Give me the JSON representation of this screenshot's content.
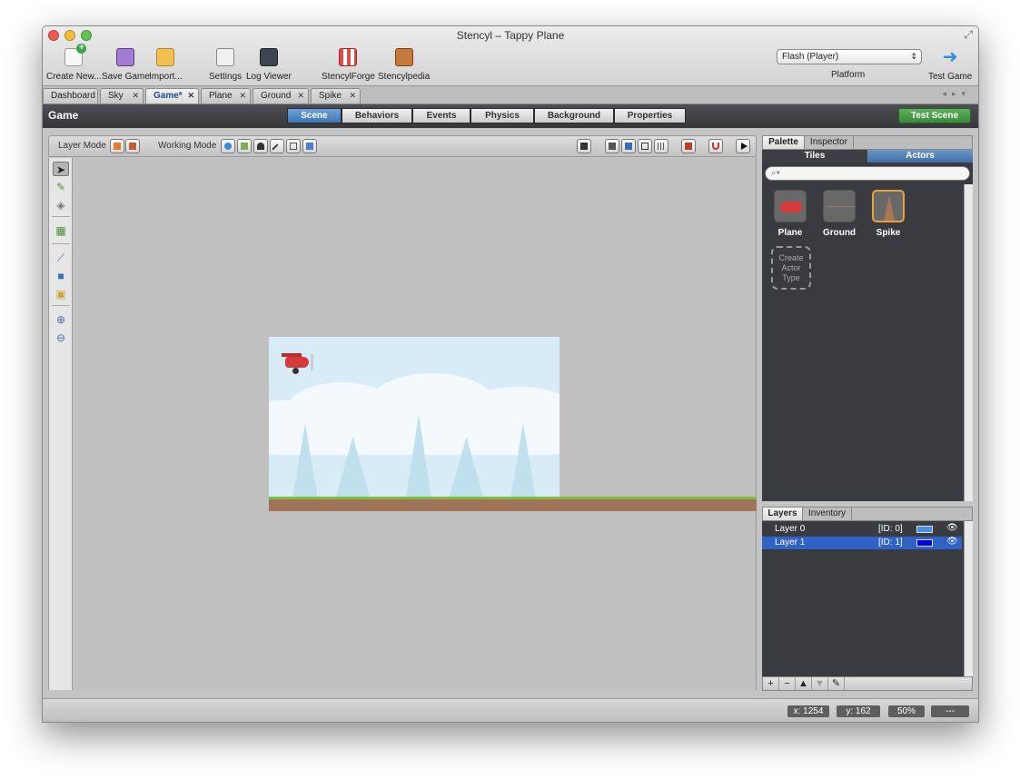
{
  "window": {
    "title": "Stencyl – Tappy Plane"
  },
  "toolbar": {
    "create_new": "Create New...",
    "save_game": "Save Game",
    "import": "Import...",
    "settings": "Settings",
    "log_viewer": "Log Viewer",
    "stencyl_forge": "StencylForge",
    "stencylpedia": "Stencylpedia",
    "platform_value": "Flash (Player)",
    "platform_label": "Platform",
    "test_game": "Test Game"
  },
  "doc_tabs": [
    {
      "label": "Dashboard",
      "closable": false
    },
    {
      "label": "Sky",
      "closable": true
    },
    {
      "label": "Game*",
      "closable": true,
      "active": true
    },
    {
      "label": "Plane",
      "closable": true
    },
    {
      "label": "Ground",
      "closable": true
    },
    {
      "label": "Spike",
      "closable": true
    }
  ],
  "header": {
    "title": "Game",
    "tabs": [
      "Scene",
      "Behaviors",
      "Events",
      "Physics",
      "Background",
      "Properties"
    ],
    "active_tab": "Scene",
    "test_scene": "Test Scene"
  },
  "editor_bar": {
    "layer_mode": "Layer Mode",
    "working_mode": "Working Mode"
  },
  "right_panel": {
    "tabs": [
      "Palette",
      "Inspector"
    ],
    "sub_tabs": [
      "Tiles",
      "Actors"
    ],
    "active_sub_tab": "Actors",
    "actors": [
      {
        "name": "Plane"
      },
      {
        "name": "Ground"
      },
      {
        "name": "Spike",
        "selected": true
      }
    ],
    "create_actor": "Create Actor Type"
  },
  "layers_panel": {
    "tabs": [
      "Layers",
      "Inventory"
    ],
    "rows": [
      {
        "name": "Layer 0",
        "id": "[ID: 0]",
        "color": "#4a90e2"
      },
      {
        "name": "Layer 1",
        "id": "[ID: 1]",
        "color": "#0000ee",
        "selected": true
      }
    ],
    "buttons": [
      "+",
      "−",
      "▲",
      "▼",
      "✎"
    ]
  },
  "status": {
    "x": "x: 1254",
    "y": "y:   162",
    "zoom": "50%",
    "extra": "---"
  },
  "colors": {
    "accent": "#3f77b5",
    "test_scene": "#3a8a3a",
    "layer_sel": "#2f63c7"
  }
}
